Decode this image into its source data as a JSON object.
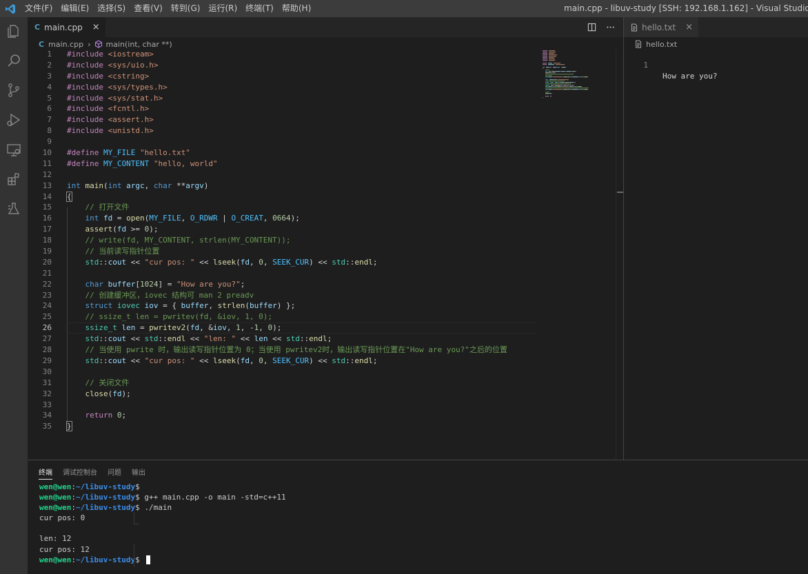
{
  "titlebar": {
    "menu": [
      "文件(F)",
      "编辑(E)",
      "选择(S)",
      "查看(V)",
      "转到(G)",
      "运行(R)",
      "终端(T)",
      "帮助(H)"
    ],
    "window_title": "main.cpp - libuv-study [SSH: 192.168.1.162] - Visual Studio Code"
  },
  "activity_bar": [
    "explorer-icon",
    "search-icon",
    "source-control-icon",
    "run-debug-icon",
    "remote-explorer-icon",
    "extensions-icon",
    "testing-icon"
  ],
  "editor1": {
    "tab": {
      "label": "main.cpp",
      "icon": "C",
      "close": "×"
    },
    "breadcrumb": {
      "file": "main.cpp",
      "symbol": "main(int, char **)"
    },
    "active_line": 26,
    "line_numbers": [
      "1",
      "2",
      "3",
      "4",
      "5",
      "6",
      "7",
      "8",
      "9",
      "10",
      "11",
      "12",
      "13",
      "14",
      "15",
      "16",
      "17",
      "18",
      "19",
      "20",
      "21",
      "22",
      "23",
      "24",
      "25",
      "26",
      "27",
      "28",
      "29",
      "30",
      "31",
      "32",
      "33",
      "34",
      "35"
    ]
  },
  "editor2": {
    "tab": {
      "label": "hello.txt",
      "close": "×"
    },
    "breadcrumb": {
      "file": "hello.txt"
    },
    "lines": [
      {
        "num": "1",
        "text": "How are you?"
      }
    ]
  },
  "panel": {
    "tabs": [
      "终端",
      "调试控制台",
      "问题",
      "输出"
    ],
    "active_tab": "终端",
    "prompt_user": "wen@wen",
    "prompt_path": "~/libuv-study",
    "terminal_lines": [
      {
        "prompt": true,
        "cmd": ""
      },
      {
        "prompt": true,
        "cmd": " g++ main.cpp -o main -std=c++11"
      },
      {
        "prompt": true,
        "cmd": " ./main"
      },
      {
        "prompt": false,
        "text": "cur pos: 0"
      },
      {
        "prompt": false,
        "text": ""
      },
      {
        "prompt": false,
        "text": "len: 12"
      },
      {
        "prompt": false,
        "text": "cur pos: 12"
      },
      {
        "prompt": true,
        "cmd": " ",
        "cursor": true
      }
    ]
  },
  "colors": {
    "keyword": "#569cd6",
    "preprocessor": "#c586c0",
    "string": "#ce9178",
    "comment": "#6a9955",
    "type": "#4ec9b0",
    "function": "#dcdcaa",
    "variable": "#9cdcfe",
    "number": "#b5cea8",
    "terminal_user": "#23d18b",
    "terminal_path": "#3b8eea",
    "vscode_blue": "#007acc"
  },
  "source": {
    "code": [
      [
        [
          "p",
          "#include"
        ],
        [
          "",
          ""
        ],
        [
          "s",
          "<iostream>"
        ]
      ],
      [
        [
          "p",
          "#include"
        ],
        [
          "",
          ""
        ],
        [
          "s",
          "<sys/uio.h>"
        ]
      ],
      [
        [
          "p",
          "#include"
        ],
        [
          "",
          ""
        ],
        [
          "s",
          "<cstring>"
        ]
      ],
      [
        [
          "p",
          "#include"
        ],
        [
          "",
          ""
        ],
        [
          "s",
          "<sys/types.h>"
        ]
      ],
      [
        [
          "p",
          "#include"
        ],
        [
          "",
          ""
        ],
        [
          "s",
          "<sys/stat.h>"
        ]
      ],
      [
        [
          "p",
          "#include"
        ],
        [
          "",
          ""
        ],
        [
          "s",
          "<fcntl.h>"
        ]
      ],
      [
        [
          "p",
          "#include"
        ],
        [
          "",
          ""
        ],
        [
          "s",
          "<assert.h>"
        ]
      ],
      [
        [
          "p",
          "#include"
        ],
        [
          "",
          ""
        ],
        [
          "s",
          "<unistd.h>"
        ]
      ],
      [],
      [
        [
          "p",
          "#define"
        ],
        [
          "",
          ""
        ],
        [
          "m",
          "MY_FILE"
        ],
        [
          "",
          ""
        ],
        [
          "s",
          "\"hello.txt\""
        ]
      ],
      [
        [
          "p",
          "#define"
        ],
        [
          "",
          ""
        ],
        [
          "m",
          "MY_CONTENT"
        ],
        [
          "",
          ""
        ],
        [
          "s",
          "\"hello, world\""
        ]
      ],
      [],
      [
        [
          "k",
          "int"
        ],
        [
          "",
          ""
        ],
        [
          "f",
          "main"
        ],
        [
          "",
          "("
        ],
        [
          "k",
          "int"
        ],
        [
          "",
          ""
        ],
        [
          "v",
          "argc"
        ],
        [
          "",
          ", "
        ],
        [
          "k",
          "char"
        ],
        [
          "",
          ""
        ],
        [
          "",
          "**"
        ],
        [
          "v",
          "argv"
        ],
        [
          "",
          ")"
        ]
      ],
      [
        [
          "bm",
          "{"
        ]
      ],
      [
        [
          "",
          "    "
        ],
        [
          "c",
          "// 打开文件"
        ]
      ],
      [
        [
          "",
          "    "
        ],
        [
          "k",
          "int"
        ],
        [
          "",
          ""
        ],
        [
          "v",
          "fd"
        ],
        [
          "",
          " = "
        ],
        [
          "f",
          "open"
        ],
        [
          "",
          "("
        ],
        [
          "m",
          "MY_FILE"
        ],
        [
          "",
          ", "
        ],
        [
          "m",
          "O_RDWR"
        ],
        [
          "",
          " | "
        ],
        [
          "m",
          "O_CREAT"
        ],
        [
          "",
          ", "
        ],
        [
          "n",
          "0664"
        ],
        [
          "",
          ");"
        ]
      ],
      [
        [
          "",
          "    "
        ],
        [
          "f",
          "assert"
        ],
        [
          "",
          "("
        ],
        [
          "v",
          "fd"
        ],
        [
          "",
          " >= "
        ],
        [
          "n",
          "0"
        ],
        [
          "",
          ");"
        ]
      ],
      [
        [
          "",
          "    "
        ],
        [
          "c",
          "// write(fd, MY_CONTENT, strlen(MY_CONTENT));"
        ]
      ],
      [
        [
          "",
          "    "
        ],
        [
          "c",
          "// 当前读写指针位置"
        ]
      ],
      [
        [
          "",
          "    "
        ],
        [
          "t",
          "std"
        ],
        [
          "",
          "::"
        ],
        [
          "v",
          "cout"
        ],
        [
          "",
          " << "
        ],
        [
          "s",
          "\"cur pos: \""
        ],
        [
          "",
          " << "
        ],
        [
          "f",
          "lseek"
        ],
        [
          "",
          "("
        ],
        [
          "v",
          "fd"
        ],
        [
          "",
          ", "
        ],
        [
          "n",
          "0"
        ],
        [
          "",
          ", "
        ],
        [
          "m",
          "SEEK_CUR"
        ],
        [
          "",
          ") << "
        ],
        [
          "t",
          "std"
        ],
        [
          "",
          "::"
        ],
        [
          "f",
          "endl"
        ],
        [
          "",
          ";"
        ]
      ],
      [],
      [
        [
          "",
          "    "
        ],
        [
          "k",
          "char"
        ],
        [
          "",
          ""
        ],
        [
          "v",
          "buffer"
        ],
        [
          "",
          "["
        ],
        [
          "n",
          "1024"
        ],
        [
          "",
          "] = "
        ],
        [
          "s",
          "\"How are you?\""
        ],
        [
          "",
          ";"
        ]
      ],
      [
        [
          "",
          "    "
        ],
        [
          "c",
          "// 创建缓冲区，iovec 结构可 man 2 preadv"
        ]
      ],
      [
        [
          "",
          "    "
        ],
        [
          "k",
          "struct"
        ],
        [
          "",
          ""
        ],
        [
          "t",
          "iovec"
        ],
        [
          "",
          ""
        ],
        [
          "v",
          "iov"
        ],
        [
          "",
          " = { "
        ],
        [
          "v",
          "buffer"
        ],
        [
          "",
          ", "
        ],
        [
          "f",
          "strlen"
        ],
        [
          "",
          "("
        ],
        [
          "v",
          "buffer"
        ],
        [
          "",
          ") };"
        ]
      ],
      [
        [
          "",
          "    "
        ],
        [
          "c",
          "// ssize_t len = pwritev(fd, &iov, 1, 0);"
        ]
      ],
      [
        [
          "",
          "    "
        ],
        [
          "t",
          "ssize_t"
        ],
        [
          "",
          ""
        ],
        [
          "v",
          "len"
        ],
        [
          "",
          " = "
        ],
        [
          "f",
          "pwritev2"
        ],
        [
          "",
          "("
        ],
        [
          "v",
          "fd"
        ],
        [
          "",
          ", &"
        ],
        [
          "v",
          "iov"
        ],
        [
          "",
          ", "
        ],
        [
          "n",
          "1"
        ],
        [
          "",
          ", -"
        ],
        [
          "n",
          "1"
        ],
        [
          "",
          ", "
        ],
        [
          "n",
          "0"
        ],
        [
          "",
          ");"
        ]
      ],
      [
        [
          "",
          "    "
        ],
        [
          "t",
          "std"
        ],
        [
          "",
          "::"
        ],
        [
          "v",
          "cout"
        ],
        [
          "",
          " << "
        ],
        [
          "t",
          "std"
        ],
        [
          "",
          "::"
        ],
        [
          "f",
          "endl"
        ],
        [
          "",
          " << "
        ],
        [
          "s",
          "\"len: \""
        ],
        [
          "",
          " << "
        ],
        [
          "v",
          "len"
        ],
        [
          "",
          " << "
        ],
        [
          "t",
          "std"
        ],
        [
          "",
          "::"
        ],
        [
          "f",
          "endl"
        ],
        [
          "",
          ";"
        ]
      ],
      [
        [
          "",
          "    "
        ],
        [
          "c",
          "// 当使用 pwrite 时，输出读写指针位置为 0；当使用 pwritev2时，输出读写指针位置在\"How are you?\"之后的位置"
        ]
      ],
      [
        [
          "",
          "    "
        ],
        [
          "t",
          "std"
        ],
        [
          "",
          "::"
        ],
        [
          "v",
          "cout"
        ],
        [
          "",
          " << "
        ],
        [
          "s",
          "\"cur pos: \""
        ],
        [
          "",
          " << "
        ],
        [
          "f",
          "lseek"
        ],
        [
          "",
          "("
        ],
        [
          "v",
          "fd"
        ],
        [
          "",
          ", "
        ],
        [
          "n",
          "0"
        ],
        [
          "",
          ", "
        ],
        [
          "m",
          "SEEK_CUR"
        ],
        [
          "",
          ") << "
        ],
        [
          "t",
          "std"
        ],
        [
          "",
          "::"
        ],
        [
          "f",
          "endl"
        ],
        [
          "",
          ";"
        ]
      ],
      [],
      [
        [
          "",
          "    "
        ],
        [
          "c",
          "// 关闭文件"
        ]
      ],
      [
        [
          "",
          "    "
        ],
        [
          "f",
          "close"
        ],
        [
          "",
          "("
        ],
        [
          "v",
          "fd"
        ],
        [
          "",
          ");"
        ]
      ],
      [],
      [
        [
          "",
          "    "
        ],
        [
          "p",
          "return"
        ],
        [
          "",
          ""
        ],
        [
          "n",
          "0"
        ],
        [
          "",
          ";"
        ]
      ],
      [
        [
          "bm",
          "}"
        ]
      ]
    ]
  }
}
